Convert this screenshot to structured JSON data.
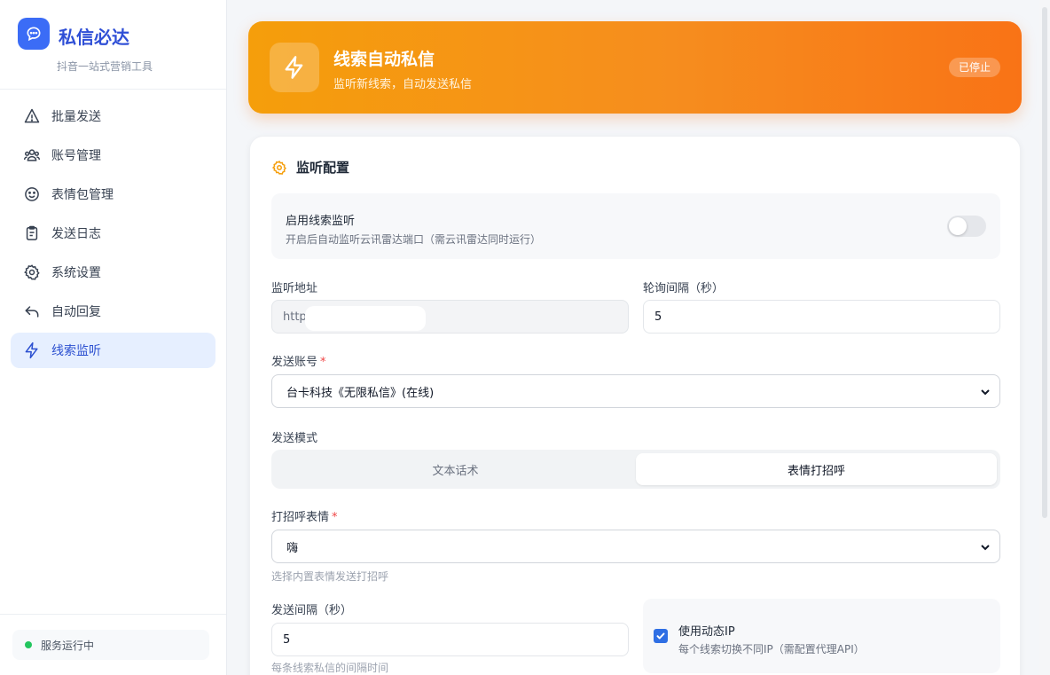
{
  "brand": {
    "name": "私信必达",
    "subtitle": "抖音一站式营销工具",
    "icon": "chat-bubble-icon",
    "color": "#3b6cf6"
  },
  "sidebar": {
    "items": [
      {
        "label": "批量发送",
        "icon": "send-icon",
        "active": false
      },
      {
        "label": "账号管理",
        "icon": "users-icon",
        "active": false
      },
      {
        "label": "表情包管理",
        "icon": "smile-icon",
        "active": false
      },
      {
        "label": "发送日志",
        "icon": "clipboard-icon",
        "active": false
      },
      {
        "label": "系统设置",
        "icon": "gear-icon",
        "active": false
      },
      {
        "label": "自动回复",
        "icon": "reply-icon",
        "active": false
      },
      {
        "label": "线索监听",
        "icon": "lightning-icon",
        "active": true
      }
    ],
    "status": {
      "label": "服务运行中",
      "color": "#22c55e"
    }
  },
  "hero": {
    "title": "线索自动私信",
    "subtitle": "监听新线索，自动发送私信",
    "badge": "已停止",
    "gradient_start": "#f59e0b",
    "gradient_end": "#f97316"
  },
  "config": {
    "title": "监听配置",
    "enable": {
      "label": "启用线索监听",
      "description": "开启后自动监听云讯雷达端口（需云讯雷达同时运行）",
      "enabled": false
    },
    "listen_address": {
      "label": "监听地址",
      "value": "http"
    },
    "poll_interval": {
      "label": "轮询间隔（秒）",
      "value": "5"
    },
    "send_account": {
      "label": "发送账号",
      "required": "*",
      "selected": "台卡科技《无限私信》(在线)"
    },
    "send_mode": {
      "label": "发送模式",
      "options": [
        "文本话术",
        "表情打招呼"
      ],
      "selected_index": 1
    },
    "greeting_emoji": {
      "label": "打招呼表情",
      "required": "*",
      "selected": "嗨",
      "hint": "选择内置表情发送打招呼"
    },
    "send_interval": {
      "label": "发送间隔（秒）",
      "value": "5",
      "hint": "每条线索私信的间隔时间"
    },
    "dynamic_ip": {
      "label": "使用动态IP",
      "description": "每个线索切换不同IP（需配置代理API）",
      "checked": true
    }
  },
  "accent_color": "#2f6fe4"
}
